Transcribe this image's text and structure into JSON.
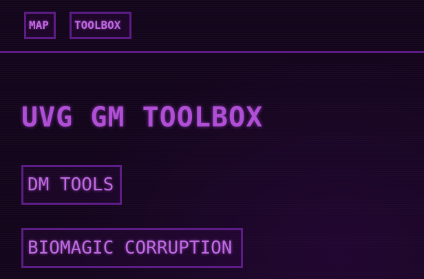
{
  "nav": {
    "map_label": "MAP",
    "toolbox_label": "TOOLBOX"
  },
  "main": {
    "title": "UVG GM TOOLBOX",
    "tools": [
      {
        "label": "DM TOOLS"
      },
      {
        "label": "BIOMAGIC CORRUPTION"
      }
    ]
  },
  "colors": {
    "background": "#13051b",
    "accent": "#b04fd6",
    "border": "#5d1d86"
  }
}
